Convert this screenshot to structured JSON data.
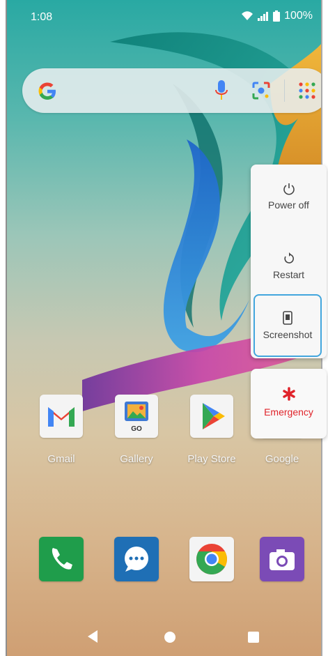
{
  "status_bar": {
    "time": "1:08",
    "battery": "100%"
  },
  "search_bar": {
    "icons": [
      "google-g-icon",
      "microphone-icon",
      "lens-icon",
      "apps-grid-icon"
    ]
  },
  "power_menu": {
    "items": [
      {
        "label": "Power off",
        "icon": "power-icon"
      },
      {
        "label": "Restart",
        "icon": "restart-icon"
      },
      {
        "label": "Screenshot",
        "icon": "screenshot-icon",
        "selected": true
      }
    ],
    "emergency": {
      "label": "Emergency",
      "icon": "asterisk-icon",
      "color": "#e0232a"
    },
    "selected_color": "#42a6dd"
  },
  "apps": [
    {
      "label": "Gmail",
      "icon": "gmail-icon"
    },
    {
      "label": "Gallery",
      "icon": "gallery-icon",
      "badge": "GO"
    },
    {
      "label": "Play Store",
      "icon": "play-store-icon"
    },
    {
      "label": "Google",
      "icon": "google-icon"
    }
  ],
  "dock": [
    {
      "icon": "phone-icon",
      "color": "#1f9d4b"
    },
    {
      "icon": "messages-icon",
      "color": "#1f6fb5"
    },
    {
      "icon": "chrome-icon"
    },
    {
      "icon": "camera-icon",
      "color": "#7b4bb6"
    }
  ],
  "nav": {
    "icons": [
      "back-icon",
      "home-icon",
      "recents-icon"
    ]
  }
}
